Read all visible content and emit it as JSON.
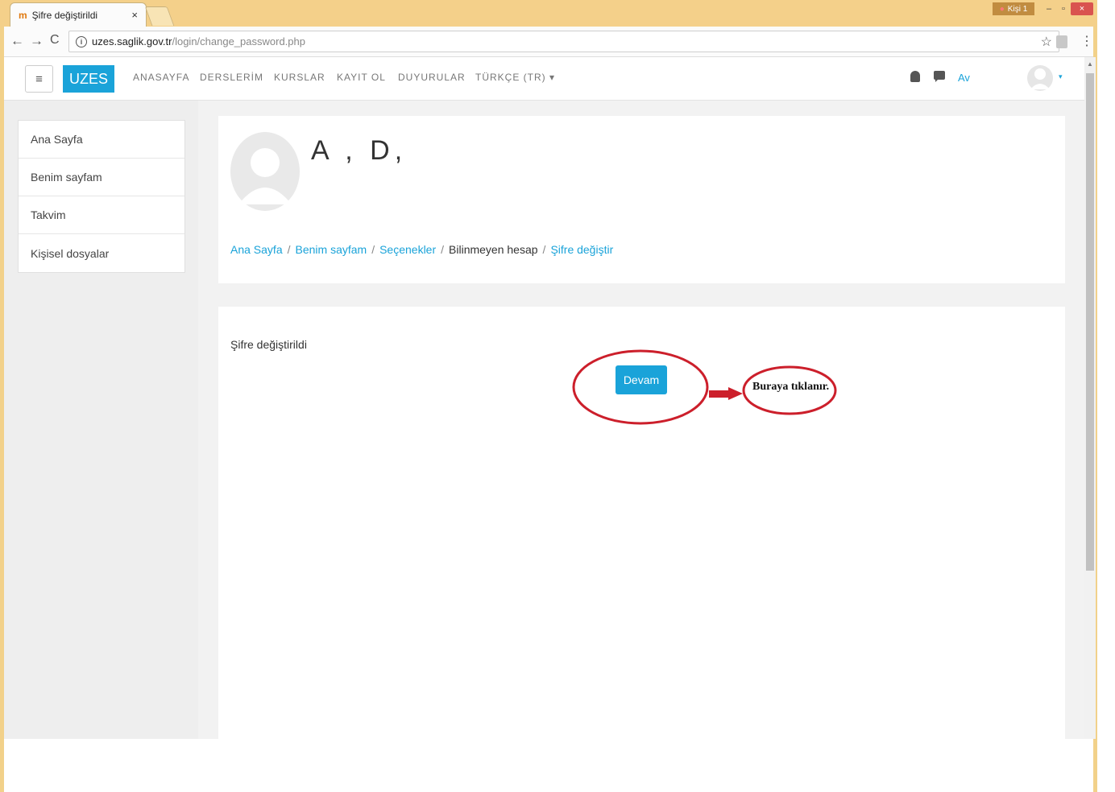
{
  "browser": {
    "tab_title": "Şifre değiştirildi",
    "tab_favicon": "m",
    "tab_close": "×",
    "profile_label": "Kişi 1",
    "window_min": "–",
    "window_max": "▫",
    "window_close": "×",
    "url_host": "uzes.saglik.gov.tr",
    "url_path": "/login/change_password.php",
    "back": "←",
    "forward": "→",
    "reload": "C",
    "info": "i",
    "star": "☆",
    "menu": "⋮"
  },
  "navbar": {
    "menu_glyph": "≡",
    "brand": "UZES",
    "links": [
      "ANASAYFA",
      "DERSLERİM",
      "KURSLAR",
      "KAYIT OL",
      "DUYURULAR",
      "TÜRKÇE (TR) ▾"
    ],
    "user_name": "Av",
    "user_caret": "▾"
  },
  "sidebar": {
    "items": [
      "Ana Sayfa",
      "Benim sayfam",
      "Takvim",
      "Kişisel dosyalar"
    ]
  },
  "header": {
    "fullname": "A  ,    D,",
    "breadcrumb": [
      {
        "label": "Ana Sayfa",
        "link": true
      },
      {
        "label": "Benim sayfam",
        "link": true
      },
      {
        "label": "Seçenekler",
        "link": true
      },
      {
        "label": "Bilinmeyen hesap",
        "link": false
      },
      {
        "label": "Şifre değiştir",
        "link": true
      }
    ],
    "separator": "/"
  },
  "main": {
    "message": "Şifre değiştirildi",
    "continue_label": "Devam"
  },
  "annotation": {
    "text": "Buraya tıklanır.",
    "color": "#cc1f2b"
  },
  "colors": {
    "accent": "#1aa3d9",
    "browser_frame": "#f4d08a"
  }
}
